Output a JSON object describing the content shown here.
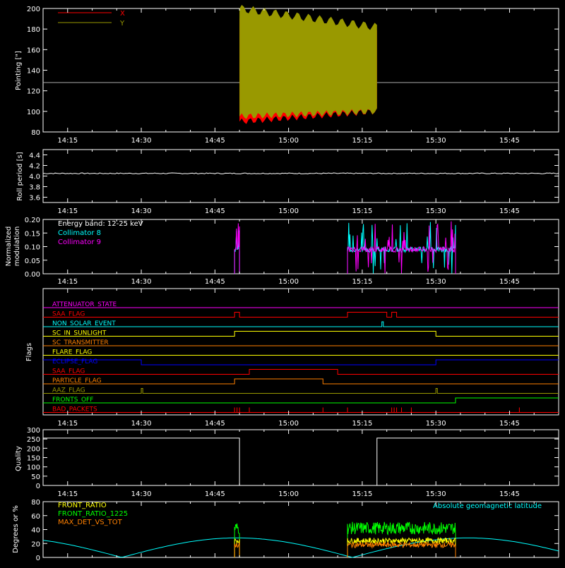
{
  "time_axis": {
    "tick_labels": [
      "14:15",
      "14:30",
      "14:45",
      "15:00",
      "15:15",
      "15:30",
      "15:45"
    ],
    "start": "14:10",
    "end": "15:55"
  },
  "colors": {
    "background": "#000000",
    "axes": "#ffffff",
    "x": "#ff0000",
    "y": "#999900",
    "cyan": "#00ffff",
    "magenta": "#ff00ff",
    "green": "#00ff00",
    "orange": "#ff8000",
    "yellow": "#ffff00"
  },
  "chart_data": [
    {
      "id": "pointing",
      "type": "area",
      "ylabel": "Pointing [\"]",
      "ylim": [
        80,
        200
      ],
      "yticks": [
        80,
        100,
        120,
        140,
        160,
        180,
        200
      ],
      "reference_line": 128,
      "legend": [
        "X",
        "Y"
      ],
      "series": [
        {
          "name": "X",
          "color": "#ff0000",
          "time_range": [
            "14:50",
            "15:18"
          ],
          "min_range": [
            90,
            100
          ],
          "max_range": [
            168,
            190
          ]
        },
        {
          "name": "Y",
          "color": "#999900",
          "time_range": [
            "14:50",
            "15:18"
          ],
          "min_range": [
            95,
            100
          ],
          "max_range": [
            170,
            200
          ]
        }
      ]
    },
    {
      "id": "roll",
      "type": "line",
      "ylabel": "Roll period [s]",
      "ylim": [
        3.5,
        4.5
      ],
      "yticks": [
        "3.6",
        "3.8",
        "4.0",
        "4.2",
        "4.4"
      ],
      "series": [
        {
          "name": "",
          "value": 4.05
        }
      ]
    },
    {
      "id": "modulation",
      "type": "line",
      "ylabel": "Normalized modulation",
      "ylim": [
        0,
        0.2
      ],
      "yticks": [
        "0.00",
        "0.05",
        "0.10",
        "0.15",
        "0.20"
      ],
      "legend_title": "Energy band: 12-25 keV",
      "series": [
        {
          "name": "Collimator 8",
          "color": "#00ffff",
          "active": [
            [
              "14:49",
              "14:50"
            ],
            [
              "15:12",
              "15:34"
            ]
          ],
          "baseline": 0.09
        },
        {
          "name": "Collimator 9",
          "color": "#ff00ff",
          "active": [
            [
              "14:49",
              "14:50"
            ],
            [
              "15:12",
              "15:34"
            ]
          ],
          "baseline": 0.09
        }
      ]
    },
    {
      "id": "flags",
      "type": "line",
      "ylabel": "Flags",
      "flags": [
        {
          "label": "ATTENUATOR_STATE",
          "color": "#ff00ff"
        },
        {
          "label": "SAA_FLAG",
          "color": "#ff0000",
          "pulses": [
            [
              "14:49",
              "14:50"
            ],
            [
              "15:12",
              "15:20"
            ],
            [
              "15:21",
              "15:22"
            ]
          ]
        },
        {
          "label": "NON_SOLAR_EVENT",
          "color": "#00ffff",
          "pulses": [
            [
              "15:19",
              "15:19.3"
            ]
          ]
        },
        {
          "label": "SC_IN_SUNLIGHT",
          "color": "#ffff00",
          "pulses": [
            [
              "14:49",
              "15:30"
            ]
          ]
        },
        {
          "label": "SC_TRANSMITTER",
          "color": "#ff8000"
        },
        {
          "label": "FLARE_FLAG",
          "color": "#ffff00"
        },
        {
          "label": "ECLIPSE_FLAG",
          "color": "#0000ff",
          "pulses": [
            [
              "14:10",
              "14:30"
            ],
            [
              "15:30",
              "15:55"
            ]
          ]
        },
        {
          "label": "SAA_FLAG",
          "color": "#ff0000",
          "pulses": [
            [
              "14:52",
              "15:10"
            ]
          ]
        },
        {
          "label": "PARTICLE_FLAG",
          "color": "#ff8000",
          "pulses": [
            [
              "14:49",
              "15:07"
            ]
          ]
        },
        {
          "label": "AAZ_FLAG",
          "color": "#999900",
          "pulses": [
            [
              "14:30",
              "14:30.3"
            ],
            [
              "15:30",
              "15:30.3"
            ]
          ]
        },
        {
          "label": "FRONTS_OFF",
          "color": "#00ff00",
          "pulses": [
            [
              "15:34",
              "15:55"
            ]
          ]
        },
        {
          "label": "BAD_PACKETS",
          "color": "#ff0000",
          "spikes": [
            "14:49",
            "14:49.5",
            "14:50",
            "14:52",
            "15:07",
            "15:12",
            "15:21",
            "15:21.5",
            "15:22",
            "15:23",
            "15:25",
            "15:47"
          ]
        }
      ]
    },
    {
      "id": "quality",
      "type": "line",
      "ylabel": "Quality",
      "ylim": [
        0,
        300
      ],
      "yticks": [
        0,
        50,
        100,
        150,
        200,
        250,
        300
      ],
      "series": [
        {
          "name": "",
          "segments": [
            [
              "14:10",
              "14:50",
              255
            ],
            [
              "14:50",
              "15:18",
              0
            ],
            [
              "15:18",
              "15:55",
              255
            ]
          ]
        }
      ]
    },
    {
      "id": "ratios",
      "type": "line",
      "ylabel": "Degrees or %",
      "ylim": [
        0,
        80
      ],
      "yticks": [
        0,
        20,
        40,
        60,
        80
      ],
      "series": [
        {
          "name": "FRONT_RATIO",
          "color": "#ffff00"
        },
        {
          "name": "FRONT_RATIO_1225",
          "color": "#00ff00"
        },
        {
          "name": "MAX_DET_VS_TOT",
          "color": "#ff8000"
        },
        {
          "name": "Absolute geomagnetic latitude",
          "color": "#00ffff"
        }
      ]
    }
  ]
}
